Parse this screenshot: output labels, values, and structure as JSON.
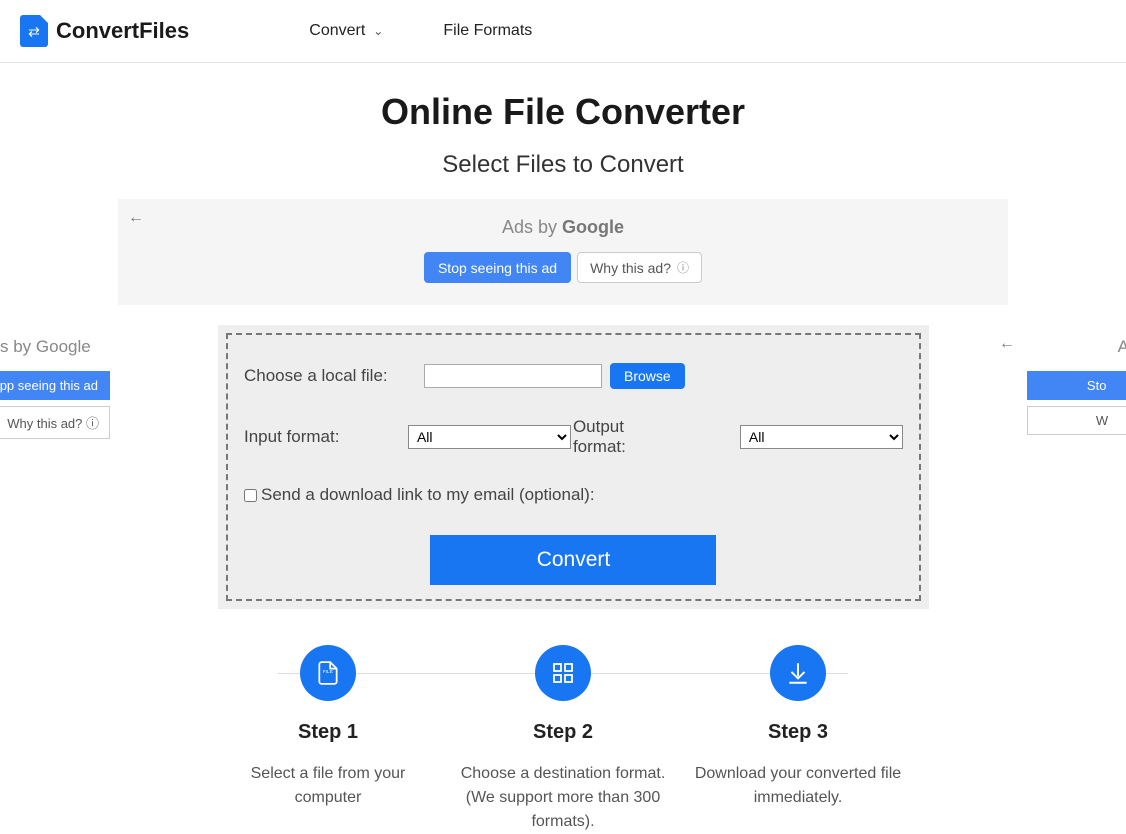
{
  "brand": "ConvertFiles",
  "nav": {
    "convert": "Convert",
    "file_formats": "File Formats"
  },
  "page": {
    "title": "Online File Converter",
    "subtitle": "Select Files to Convert"
  },
  "ads": {
    "label_prefix": "Ads by ",
    "label_brand": "Google",
    "stop": "Stop seeing this ad",
    "why": "Why this ad?",
    "side_left_label": "s by Google",
    "side_left_stop": "pp seeing this ad",
    "side_left_why": "Why this ad? ⓘ",
    "side_right_label": "Ads",
    "side_right_stop": "Sto",
    "side_right_why": "W"
  },
  "form": {
    "choose_local_file": "Choose a local file:",
    "browse": "Browse",
    "input_format": "Input format:",
    "output_format": "Output format:",
    "all_option": "All",
    "send_email": "Send a download link to my email (optional):",
    "convert": "Convert"
  },
  "steps": [
    {
      "title": "Step 1",
      "desc": "Select a file from your computer"
    },
    {
      "title": "Step 2",
      "desc": "Choose a destination format. (We support more than 300 formats)."
    },
    {
      "title": "Step 3",
      "desc": "Download your converted file immediately."
    }
  ]
}
